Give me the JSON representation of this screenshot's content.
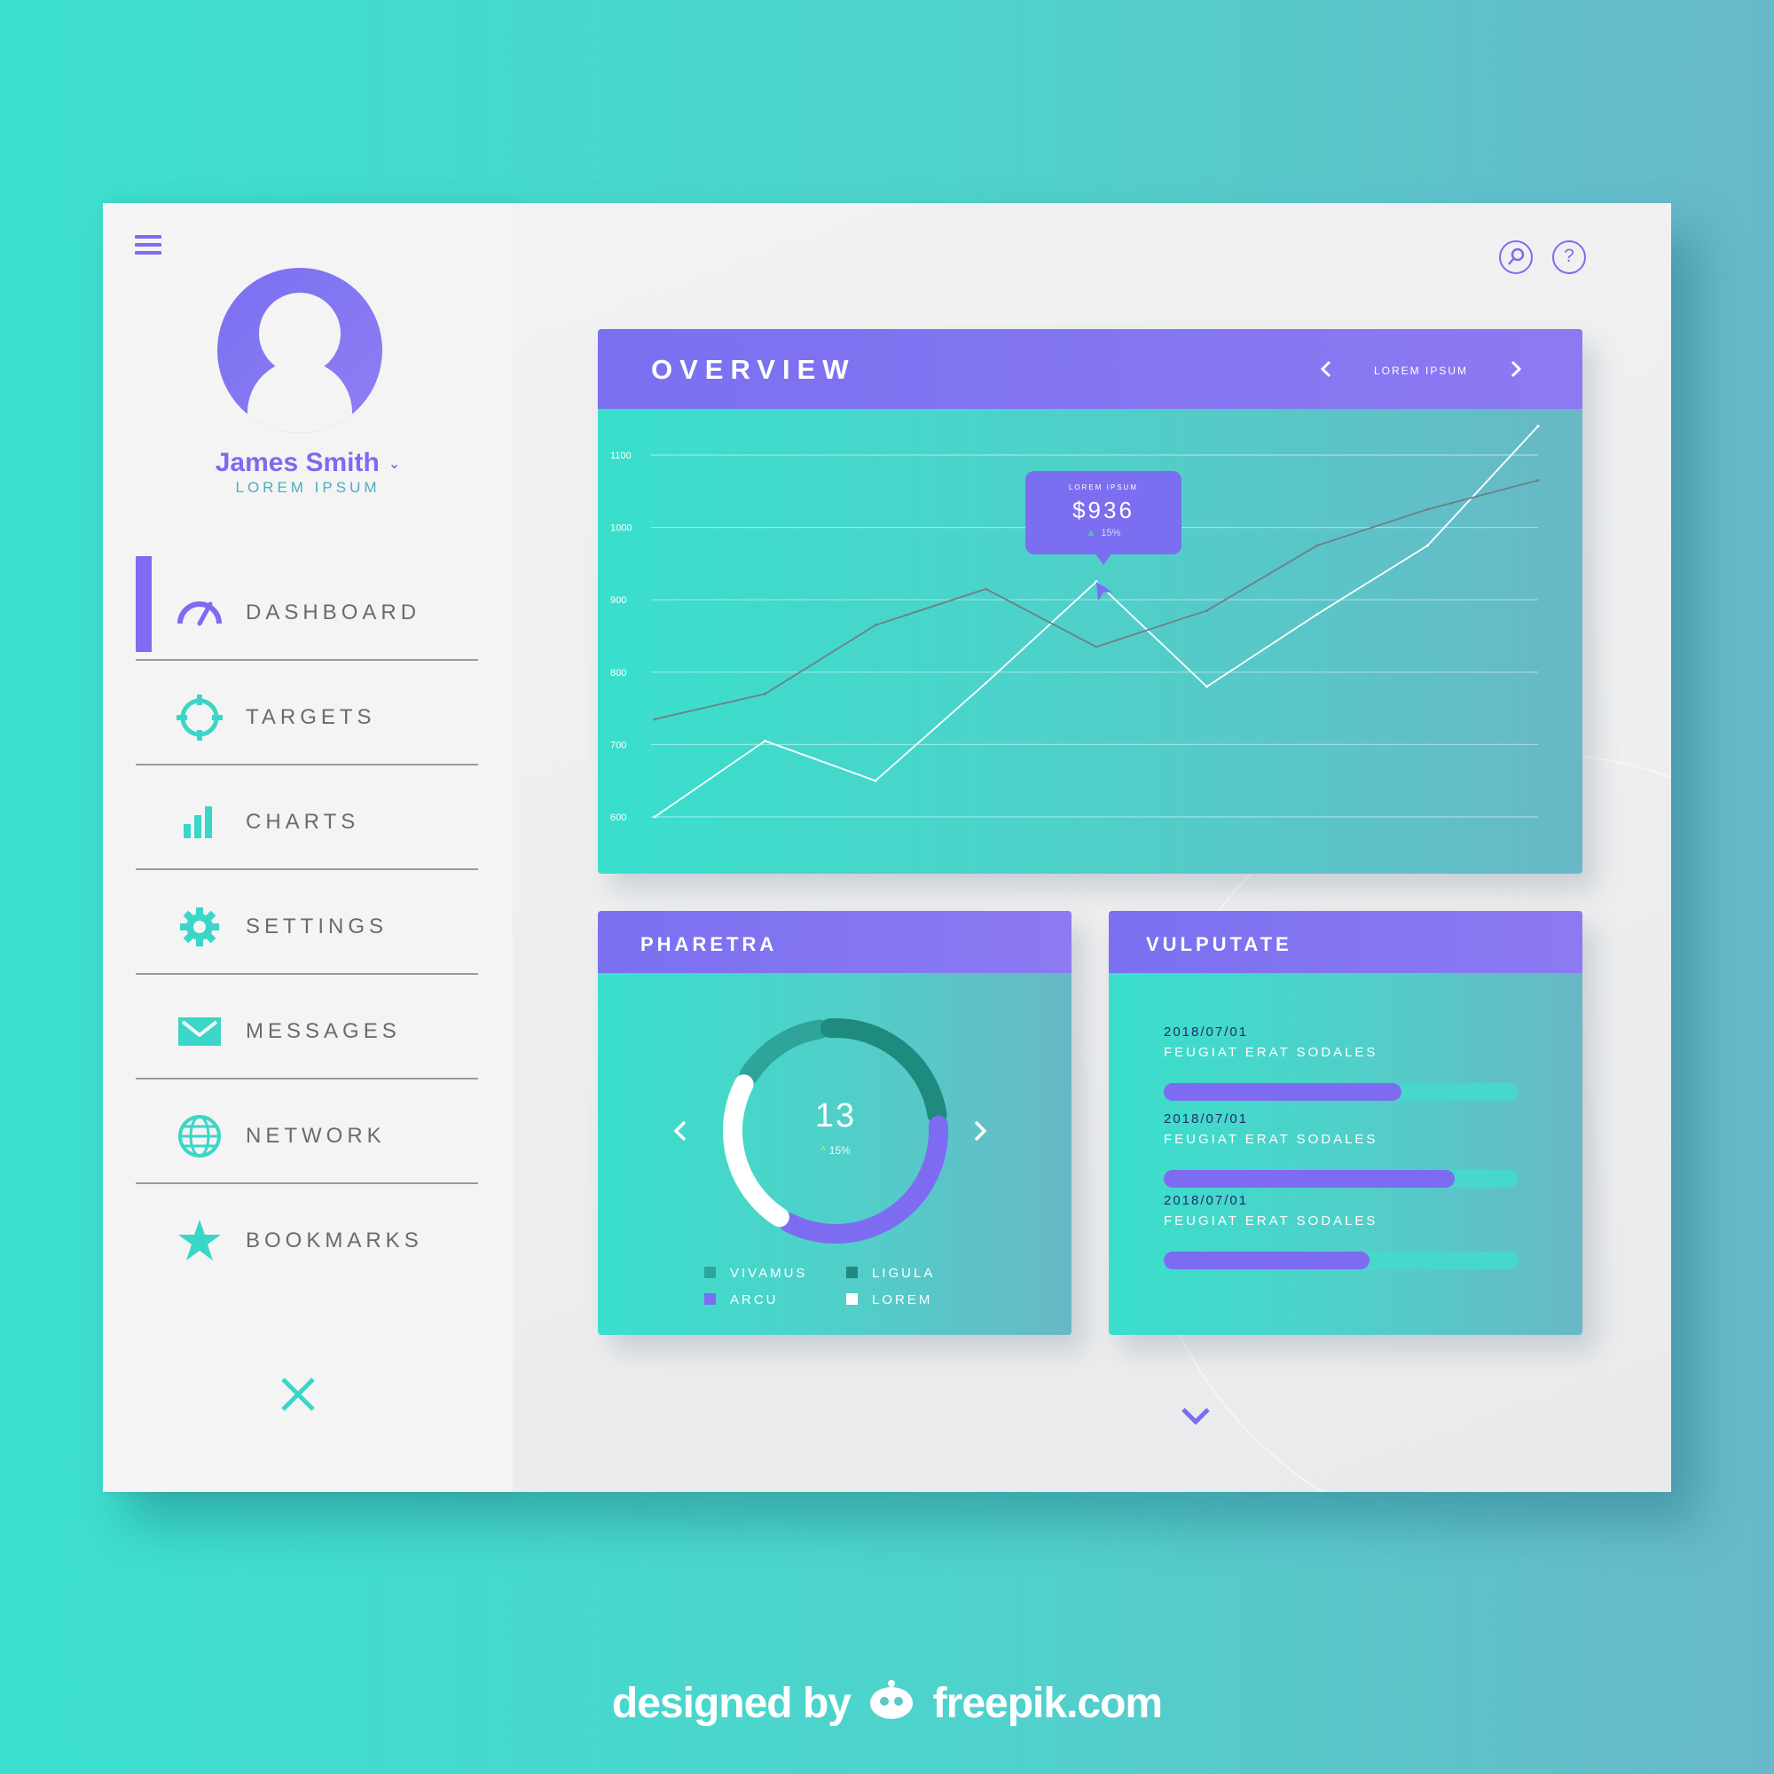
{
  "user": {
    "name": "James Smith",
    "role": "LOREM IPSUM"
  },
  "nav": {
    "items": [
      {
        "label": "DASHBOARD",
        "active": true
      },
      {
        "label": "TARGETS"
      },
      {
        "label": "CHARTS"
      },
      {
        "label": "SETTINGS"
      },
      {
        "label": "MESSAGES"
      },
      {
        "label": "NETWORK"
      },
      {
        "label": "BOOKMARKS"
      }
    ]
  },
  "colors": {
    "accent": "#7d6cf2",
    "teal": "#3ce0cf",
    "text": "#6b6b6b"
  },
  "icons": [
    "menu-icon",
    "search-icon",
    "help-icon",
    "close-icon",
    "chevron-down-icon"
  ],
  "overview": {
    "title": "OVERVIEW",
    "nav_label": "LOREM IPSUM",
    "tooltip": {
      "label": "LOREM IPSUM",
      "value": "$936",
      "change": "15%"
    }
  },
  "pharetra": {
    "title": "PHARETRA",
    "center_value": "13",
    "center_change": "15%",
    "legend": [
      "VIVAMUS",
      "LIGULA",
      "ARCU",
      "LOREM"
    ]
  },
  "vulputate": {
    "title": "VULPUTATE",
    "rows": [
      {
        "date": "2018/07/01",
        "desc": "FEUGIAT ERAT SODALES",
        "progress": 0.67
      },
      {
        "date": "2018/07/01",
        "desc": "FEUGIAT ERAT SODALES",
        "progress": 0.82
      },
      {
        "date": "2018/07/01",
        "desc": "FEUGIAT ERAT SODALES",
        "progress": 0.58
      }
    ]
  },
  "credit": {
    "prefix": "designed by",
    "site": "freepik.com"
  },
  "chart_data": [
    {
      "type": "line",
      "title": "OVERVIEW",
      "xlabel": "",
      "ylabel": "",
      "ylim": [
        600,
        1100
      ],
      "yticks": [
        "1100",
        "1000",
        "900",
        "800",
        "700",
        "600"
      ],
      "x": [
        0,
        1,
        2,
        3,
        4,
        5,
        6,
        7,
        8
      ],
      "series": [
        {
          "values": [
            600,
            705,
            650,
            785,
            925,
            780,
            880,
            975,
            1140
          ],
          "color": "#ffffff"
        },
        {
          "values": [
            735,
            770,
            865,
            915,
            835,
            885,
            975,
            1025,
            1065
          ],
          "color": "#6f7f86"
        }
      ],
      "grid": true
    },
    {
      "type": "pie",
      "title": "PHARETRA",
      "labels": [
        "VIVAMUS",
        "LIGULA",
        "ARCU",
        "LOREM"
      ],
      "values": [
        15,
        25,
        35,
        25
      ],
      "colors": [
        "#2fa49b",
        "#1f8a7e",
        "#7d6cf2",
        "#ffffff"
      ]
    }
  ]
}
